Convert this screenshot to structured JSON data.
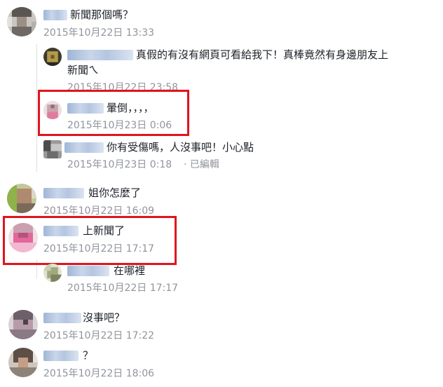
{
  "colors": {
    "highlight": "#e0141e",
    "timestamp": "#90949c",
    "text": "#1d2129",
    "thread_line": "#dddfe2"
  },
  "comments": [
    {
      "text": "新聞那個嗎？",
      "time": "2015年10月22日 13:33"
    },
    {
      "text": "真假的有沒有網頁可看給我下！真棒竟然有身邊朋友上",
      "text2": "新聞ㄟ",
      "time": "2015年10月22日 23:58"
    },
    {
      "text": "暈倒，，，，",
      "time": "2015年10月23日 0:06"
    },
    {
      "text": "你有受傷嗎，人沒事吧！小心點",
      "time": "2015年10月23日 0:18",
      "edited": "· 已編輯"
    },
    {
      "text": "姐你怎麼了",
      "time": "2015年10月22日 16:09"
    },
    {
      "text": "上新聞了",
      "time": "2015年10月22日 17:17"
    },
    {
      "text": "在哪裡",
      "time": "2015年10月22日 17:17"
    },
    {
      "text": "沒事吧？",
      "time": "2015年10月22日 17:22"
    },
    {
      "text": "？",
      "time": "2015年10月22日 18:06"
    }
  ]
}
